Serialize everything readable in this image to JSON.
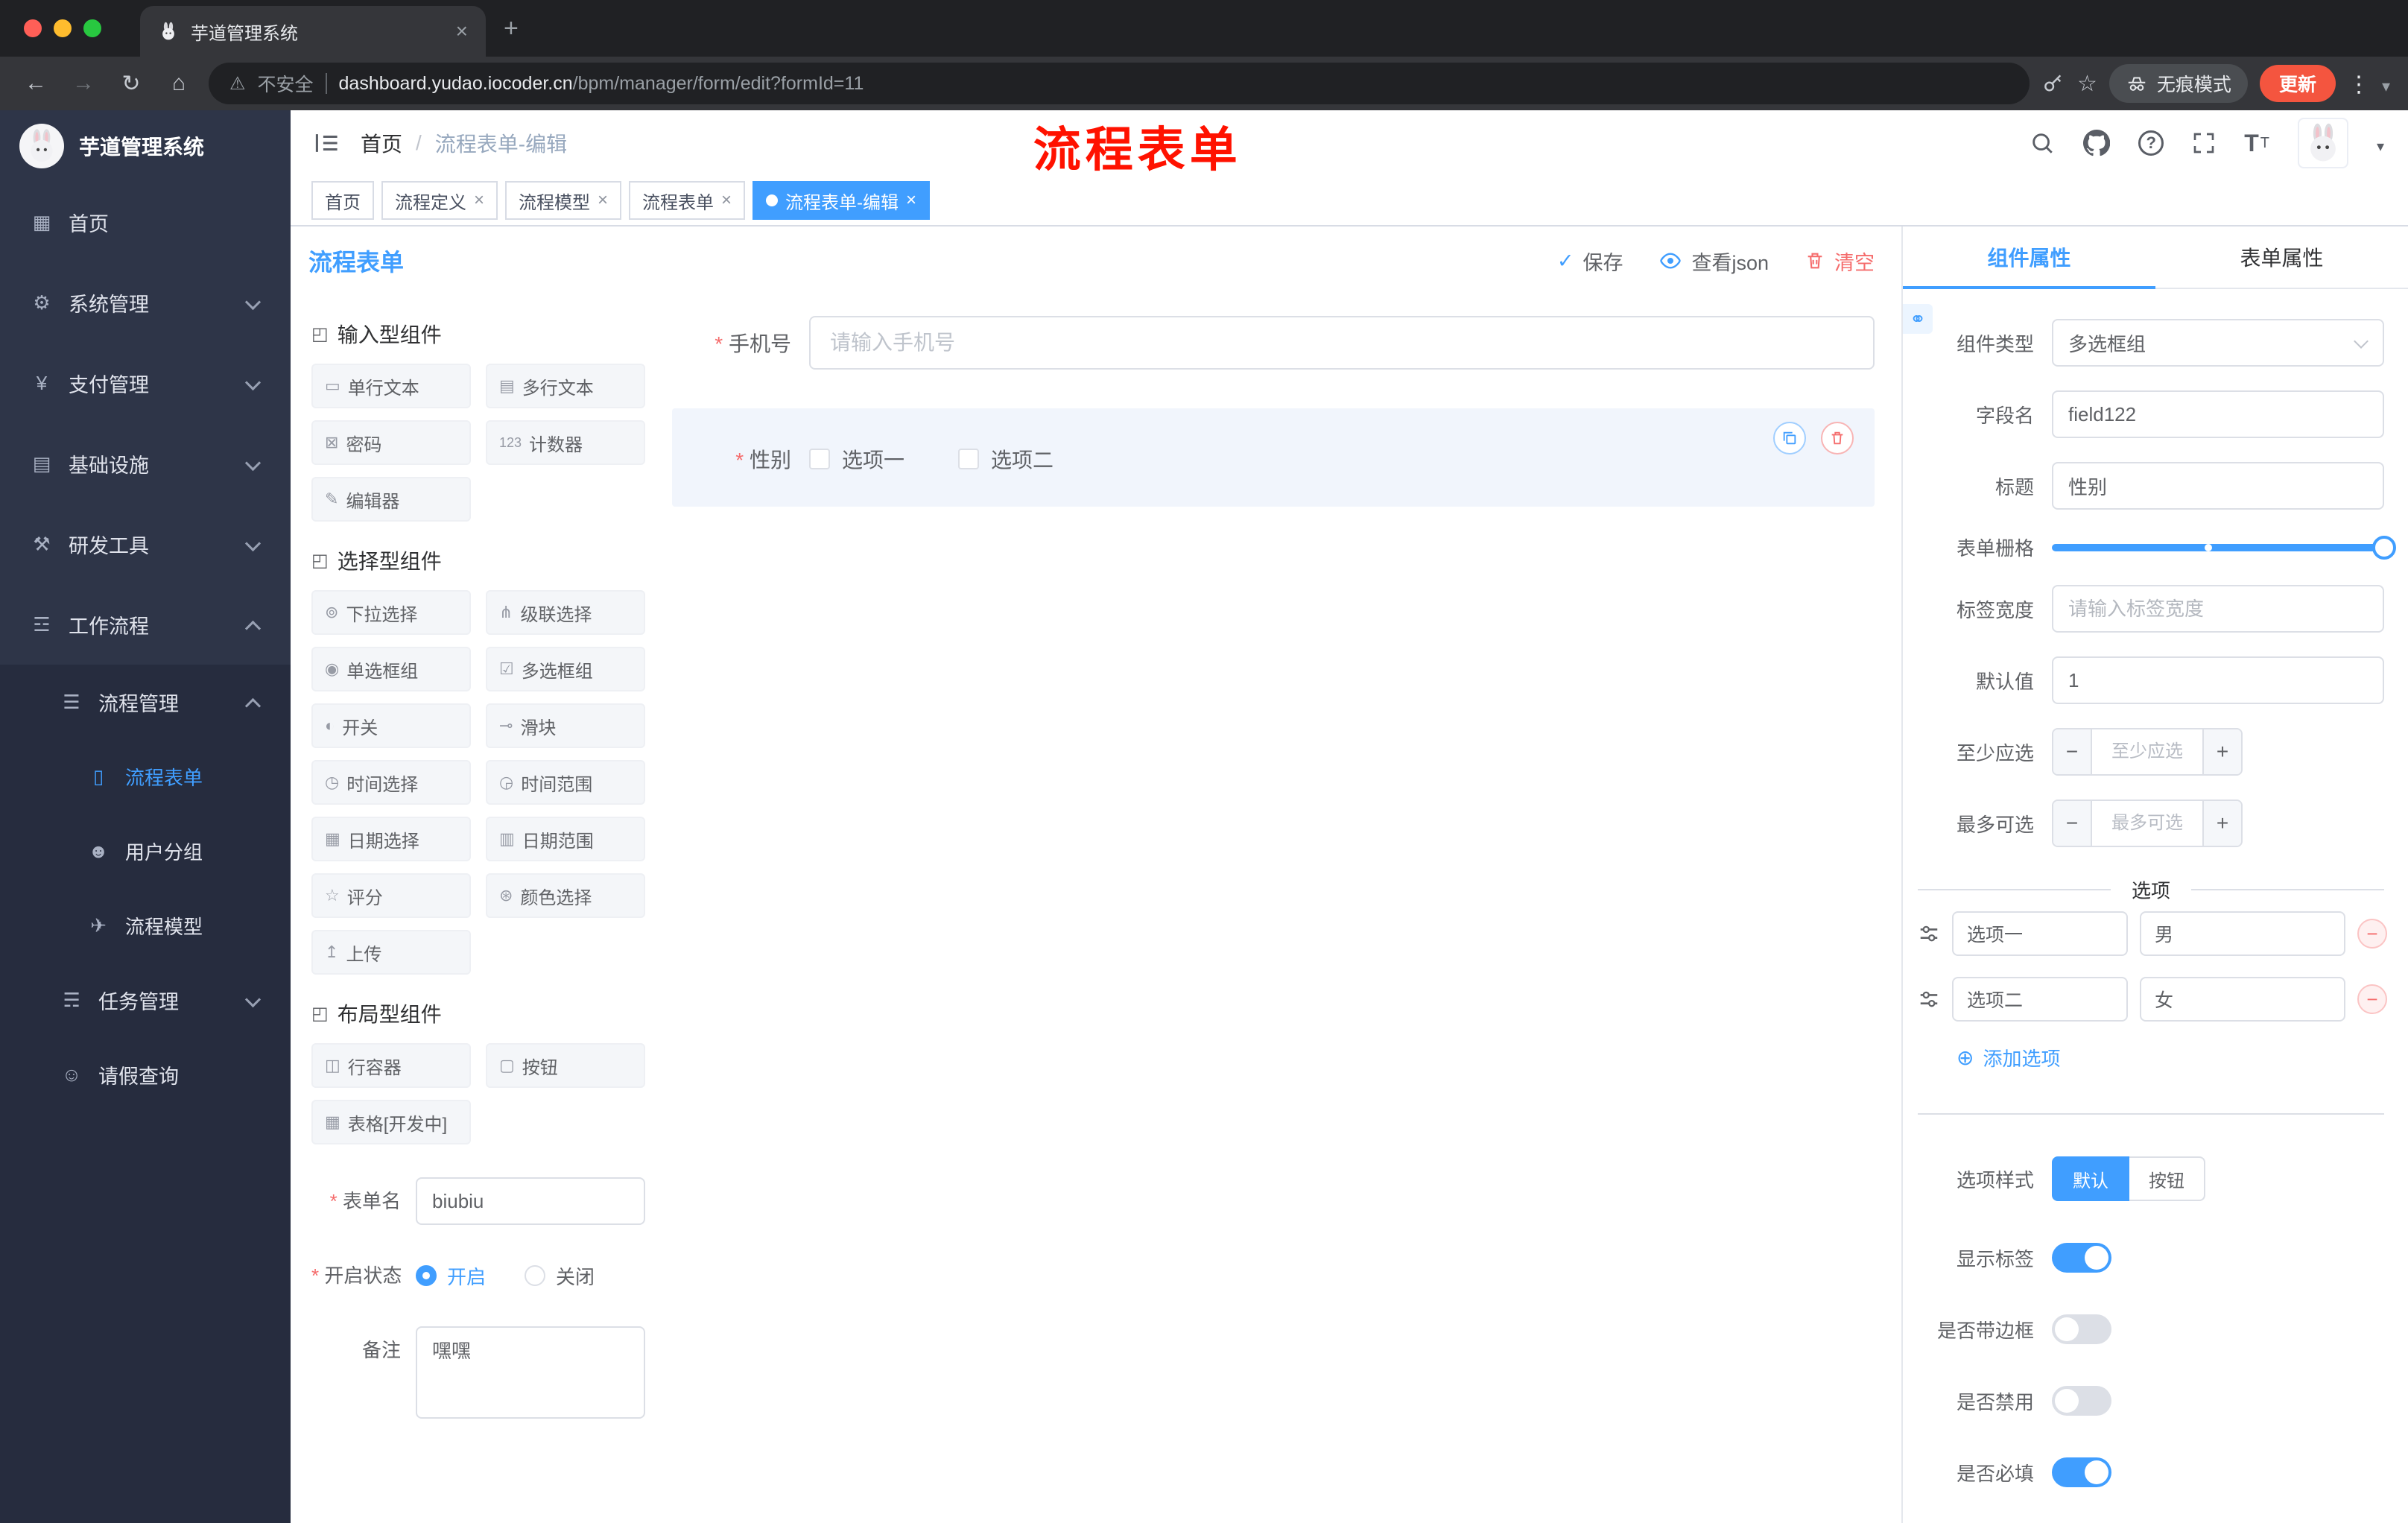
{
  "colors": {
    "primary": "#409eff",
    "danger": "#f56c6c",
    "sidebar": "#2e3548",
    "annotation": "#ff1200"
  },
  "browser": {
    "tab_title": "芋道管理系统",
    "security_label": "不安全",
    "url_host": "dashboard.yudao.iocoder.cn",
    "url_path": "/bpm/manager/form/edit?formId=11",
    "incognito_label": "无痕模式",
    "update_label": "更新"
  },
  "sidebar": {
    "logo_title": "芋道管理系统",
    "menu": [
      {
        "icon": "▦",
        "label": "首页"
      },
      {
        "icon": "⚙",
        "label": "系统管理"
      },
      {
        "icon": "¥",
        "label": "支付管理"
      },
      {
        "icon": "▤",
        "label": "基础设施"
      },
      {
        "icon": "⚒",
        "label": "研发工具"
      },
      {
        "icon": "☲",
        "label": "工作流程"
      }
    ],
    "submenu": {
      "manager": {
        "icon": "☰",
        "label": "流程管理"
      },
      "children": [
        {
          "icon": "▯",
          "label": "流程表单"
        },
        {
          "icon": "☻",
          "label": "用户分组"
        },
        {
          "icon": "✈",
          "label": "流程模型"
        }
      ],
      "tasks": {
        "icon": "☴",
        "label": "任务管理"
      },
      "leave": {
        "icon": "☺",
        "label": "请假查询"
      }
    }
  },
  "header": {
    "breadcrumb": {
      "root": "首页",
      "separator": "/",
      "current": "流程表单-编辑"
    },
    "annotation": "流程表单"
  },
  "tags": [
    {
      "label": "首页"
    },
    {
      "label": "流程定义"
    },
    {
      "label": "流程模型"
    },
    {
      "label": "流程表单"
    },
    {
      "label": "流程表单-编辑"
    }
  ],
  "designer": {
    "title": "流程表单",
    "actions": {
      "save": "保存",
      "view_json": "查看json",
      "clear": "清空"
    },
    "groups": [
      {
        "icon": "◰",
        "title": "输入型组件",
        "items": [
          {
            "icon": "▭",
            "label": "单行文本"
          },
          {
            "icon": "▤",
            "label": "多行文本"
          },
          {
            "icon": "⊠",
            "label": "密码"
          },
          {
            "icon": "123",
            "label": "计数器"
          },
          {
            "icon": "✎",
            "label": "编辑器"
          }
        ]
      },
      {
        "icon": "◰",
        "title": "选择型组件",
        "items": [
          {
            "icon": "⊚",
            "label": "下拉选择"
          },
          {
            "icon": "⋔",
            "label": "级联选择"
          },
          {
            "icon": "◉",
            "label": "单选框组"
          },
          {
            "icon": "☑",
            "label": "多选框组"
          },
          {
            "icon": "◐",
            "label": "开关"
          },
          {
            "icon": "⊸",
            "label": "滑块"
          },
          {
            "icon": "◷",
            "label": "时间选择"
          },
          {
            "icon": "◶",
            "label": "时间范围"
          },
          {
            "icon": "▦",
            "label": "日期选择"
          },
          {
            "icon": "▥",
            "label": "日期范围"
          },
          {
            "icon": "☆",
            "label": "评分"
          },
          {
            "icon": "⊛",
            "label": "颜色选择"
          },
          {
            "icon": "↥",
            "label": "上传"
          }
        ]
      },
      {
        "icon": "◰",
        "title": "布局型组件",
        "items": [
          {
            "icon": "◫",
            "label": "行容器"
          },
          {
            "icon": "▢",
            "label": "按钮"
          },
          {
            "icon": "▦",
            "label": "表格[开发中]"
          }
        ]
      }
    ],
    "form": {
      "name_label": "表单名",
      "name_value": "biubiu",
      "status_label": "开启状态",
      "status_on": "开启",
      "status_off": "关闭",
      "remark_label": "备注",
      "remark_value": "嘿嘿"
    },
    "canvas": {
      "phone": {
        "label": "手机号",
        "placeholder": "请输入手机号"
      },
      "gender": {
        "label": "性别",
        "options": [
          "选项一",
          "选项二"
        ]
      }
    }
  },
  "properties": {
    "tabs": {
      "component": "组件属性",
      "form": "表单属性"
    },
    "component_type": {
      "label": "组件类型",
      "value": "多选框组"
    },
    "field_name": {
      "label": "字段名",
      "value": "field122"
    },
    "title": {
      "label": "标题",
      "value": "性别"
    },
    "grid": {
      "label": "表单栅格"
    },
    "label_width": {
      "label": "标签宽度",
      "placeholder": "请输入标签宽度"
    },
    "default_value": {
      "label": "默认值",
      "value": "1"
    },
    "min_select": {
      "label": "至少应选",
      "placeholder": "至少应选"
    },
    "max_select": {
      "label": "最多可选",
      "placeholder": "最多可选"
    },
    "options_title": "选项",
    "options": [
      {
        "label": "选项一",
        "value": "男"
      },
      {
        "label": "选项二",
        "value": "女"
      }
    ],
    "add_option": "添加选项",
    "option_style": {
      "label": "选项样式",
      "default": "默认",
      "button": "按钮",
      "active": "默认"
    },
    "toggles": [
      {
        "label": "显示标签",
        "on": true
      },
      {
        "label": "是否带边框",
        "on": false
      },
      {
        "label": "是否禁用",
        "on": false
      },
      {
        "label": "是否必填",
        "on": true
      }
    ]
  }
}
